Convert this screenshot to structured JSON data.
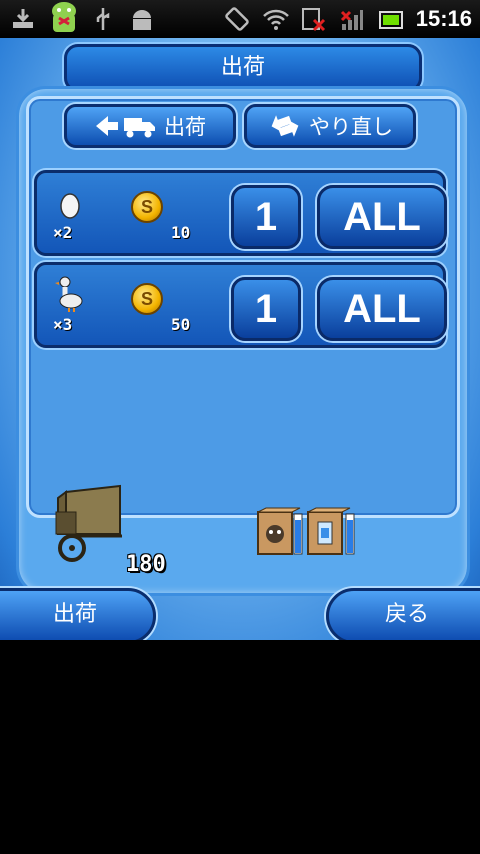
{
  "status_bar": {
    "time": "15:16",
    "icons": [
      "download-icon",
      "android-mascot-icon",
      "usb-icon",
      "android-debug-icon",
      "rotate-icon",
      "wifi-icon",
      "sim-error-icon",
      "signal-icon",
      "battery-icon"
    ]
  },
  "screen": {
    "title": "出荷",
    "top_buttons": {
      "ship_label": "出荷",
      "redo_label": "やり直し"
    },
    "rows": [
      {
        "item": "egg",
        "qty": "×2",
        "price": "10",
        "count_button": "1",
        "all_button": "ALL"
      },
      {
        "item": "goose",
        "qty": "×3",
        "price": "50",
        "count_button": "1",
        "all_button": "ALL"
      }
    ],
    "cart_count": "180",
    "bottom": {
      "ship_label": "出荷",
      "back_label": "戻る"
    }
  },
  "colors": {
    "accent_blue": "#1356b8",
    "panel_blue": "#4d9be6",
    "coin_gold": "#f3b400"
  }
}
